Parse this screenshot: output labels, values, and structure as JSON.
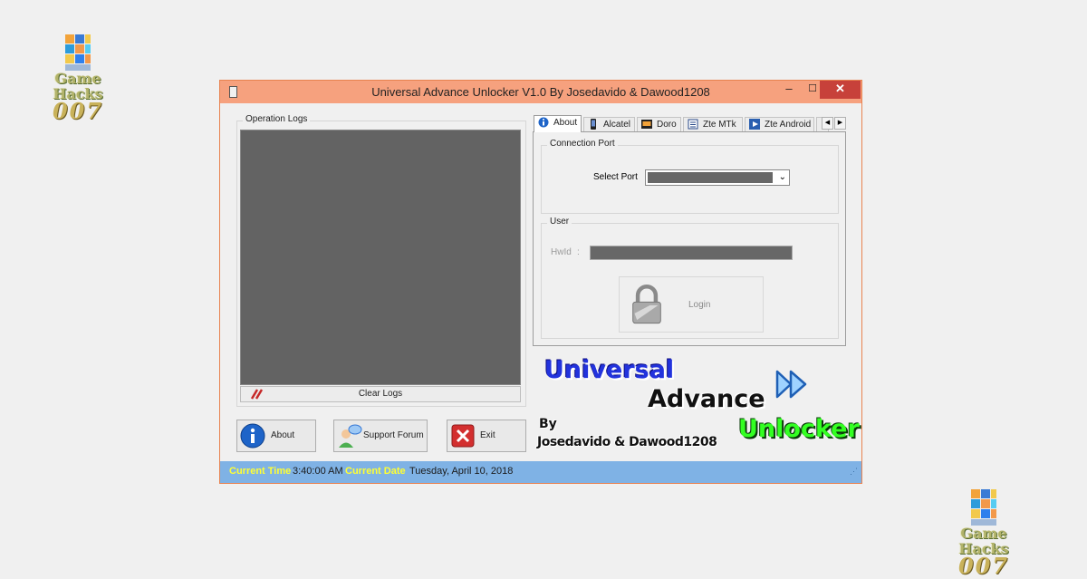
{
  "watermark": {
    "line1": "Game Hacks",
    "line2": "007"
  },
  "window": {
    "title": "Universal Advance Unlocker V1.0 By Josedavido & Dawood1208",
    "controls": {
      "minimize": "–",
      "maximize": "☐",
      "close": "✕"
    }
  },
  "logs": {
    "group_label": "Operation Logs",
    "clear_label": "Clear Logs"
  },
  "buttons": {
    "about": "About",
    "support": "Support Forum",
    "exit": "Exit"
  },
  "tabs": [
    {
      "label": "About",
      "icon": "info-icon"
    },
    {
      "label": "Alcatel",
      "icon": "phone-icon"
    },
    {
      "label": "Doro",
      "icon": "doro-icon"
    },
    {
      "label": "Zte MTk",
      "icon": "chip-icon"
    },
    {
      "label": "Zte Android",
      "icon": "play-icon"
    }
  ],
  "connection": {
    "group_label": "Connection Port",
    "select_label": "Select Port",
    "selected_value": ""
  },
  "user": {
    "group_label": "User",
    "hwid_label": "HwId",
    "hwid_sep": ":",
    "hwid_value": "",
    "login_label": "Login"
  },
  "logo": {
    "line1": "Universal",
    "line2": "Advance",
    "line3": "Unlocker",
    "by": "By",
    "authors": "Josedavido & Dawood1208"
  },
  "status": {
    "time_label": "Current Time",
    "time_value": "3:40:00 AM",
    "date_label": "Current Date",
    "date_value": "Tuesday, April 10, 2018"
  },
  "colors": {
    "titlebar": "#f6a17e",
    "statusbar": "#7fb2e5",
    "logo_blue": "#2233dd",
    "logo_green": "#33ff22",
    "status_label": "#ffff33"
  }
}
